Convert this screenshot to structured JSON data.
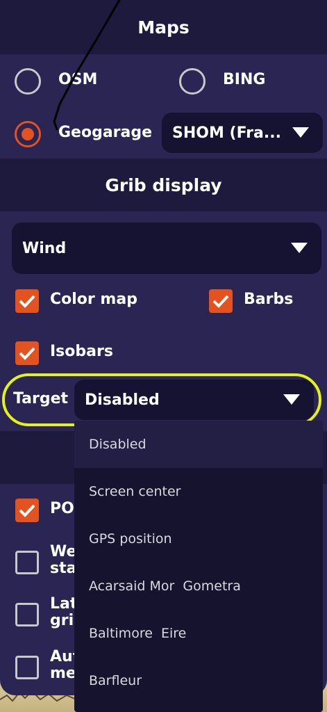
{
  "maps": {
    "title": "Maps",
    "options": [
      {
        "label": "OSM",
        "selected": false
      },
      {
        "label": "BING",
        "selected": false
      },
      {
        "label": "Geogarage",
        "selected": true
      }
    ],
    "chart_select": "SHOM (Fra..."
  },
  "grib": {
    "title": "Grib display",
    "parameter_select": "Wind",
    "checkboxes": [
      {
        "label": "Color map",
        "checked": true
      },
      {
        "label": "Barbs",
        "checked": true
      },
      {
        "label": "Isobars",
        "checked": true
      }
    ],
    "target_label": "Target",
    "target_value": "Disabled"
  },
  "lower_section": {
    "checkboxes": [
      {
        "label": "PO",
        "checked": true
      },
      {
        "label": "We\nsta",
        "checked": false
      },
      {
        "label": "Lat\ngri",
        "checked": false
      },
      {
        "label": "Aut\nme",
        "checked": false
      }
    ]
  },
  "target_dropdown": {
    "items": [
      {
        "label": "Disabled",
        "selected": true
      },
      {
        "label": "Screen center",
        "selected": false
      },
      {
        "label": "GPS position",
        "selected": false
      },
      {
        "label": "Acarsaid Mor  Gometra",
        "selected": false
      },
      {
        "label": "Baltimore  Eire",
        "selected": false
      },
      {
        "label": "Barfleur",
        "selected": false
      }
    ]
  },
  "colors": {
    "panel_bg": "#2a2552",
    "header_bg": "#1d1a3d",
    "accent": "#e2531f",
    "highlight_ring": "#e4f21a",
    "dropdown_bg": "#16132f"
  }
}
